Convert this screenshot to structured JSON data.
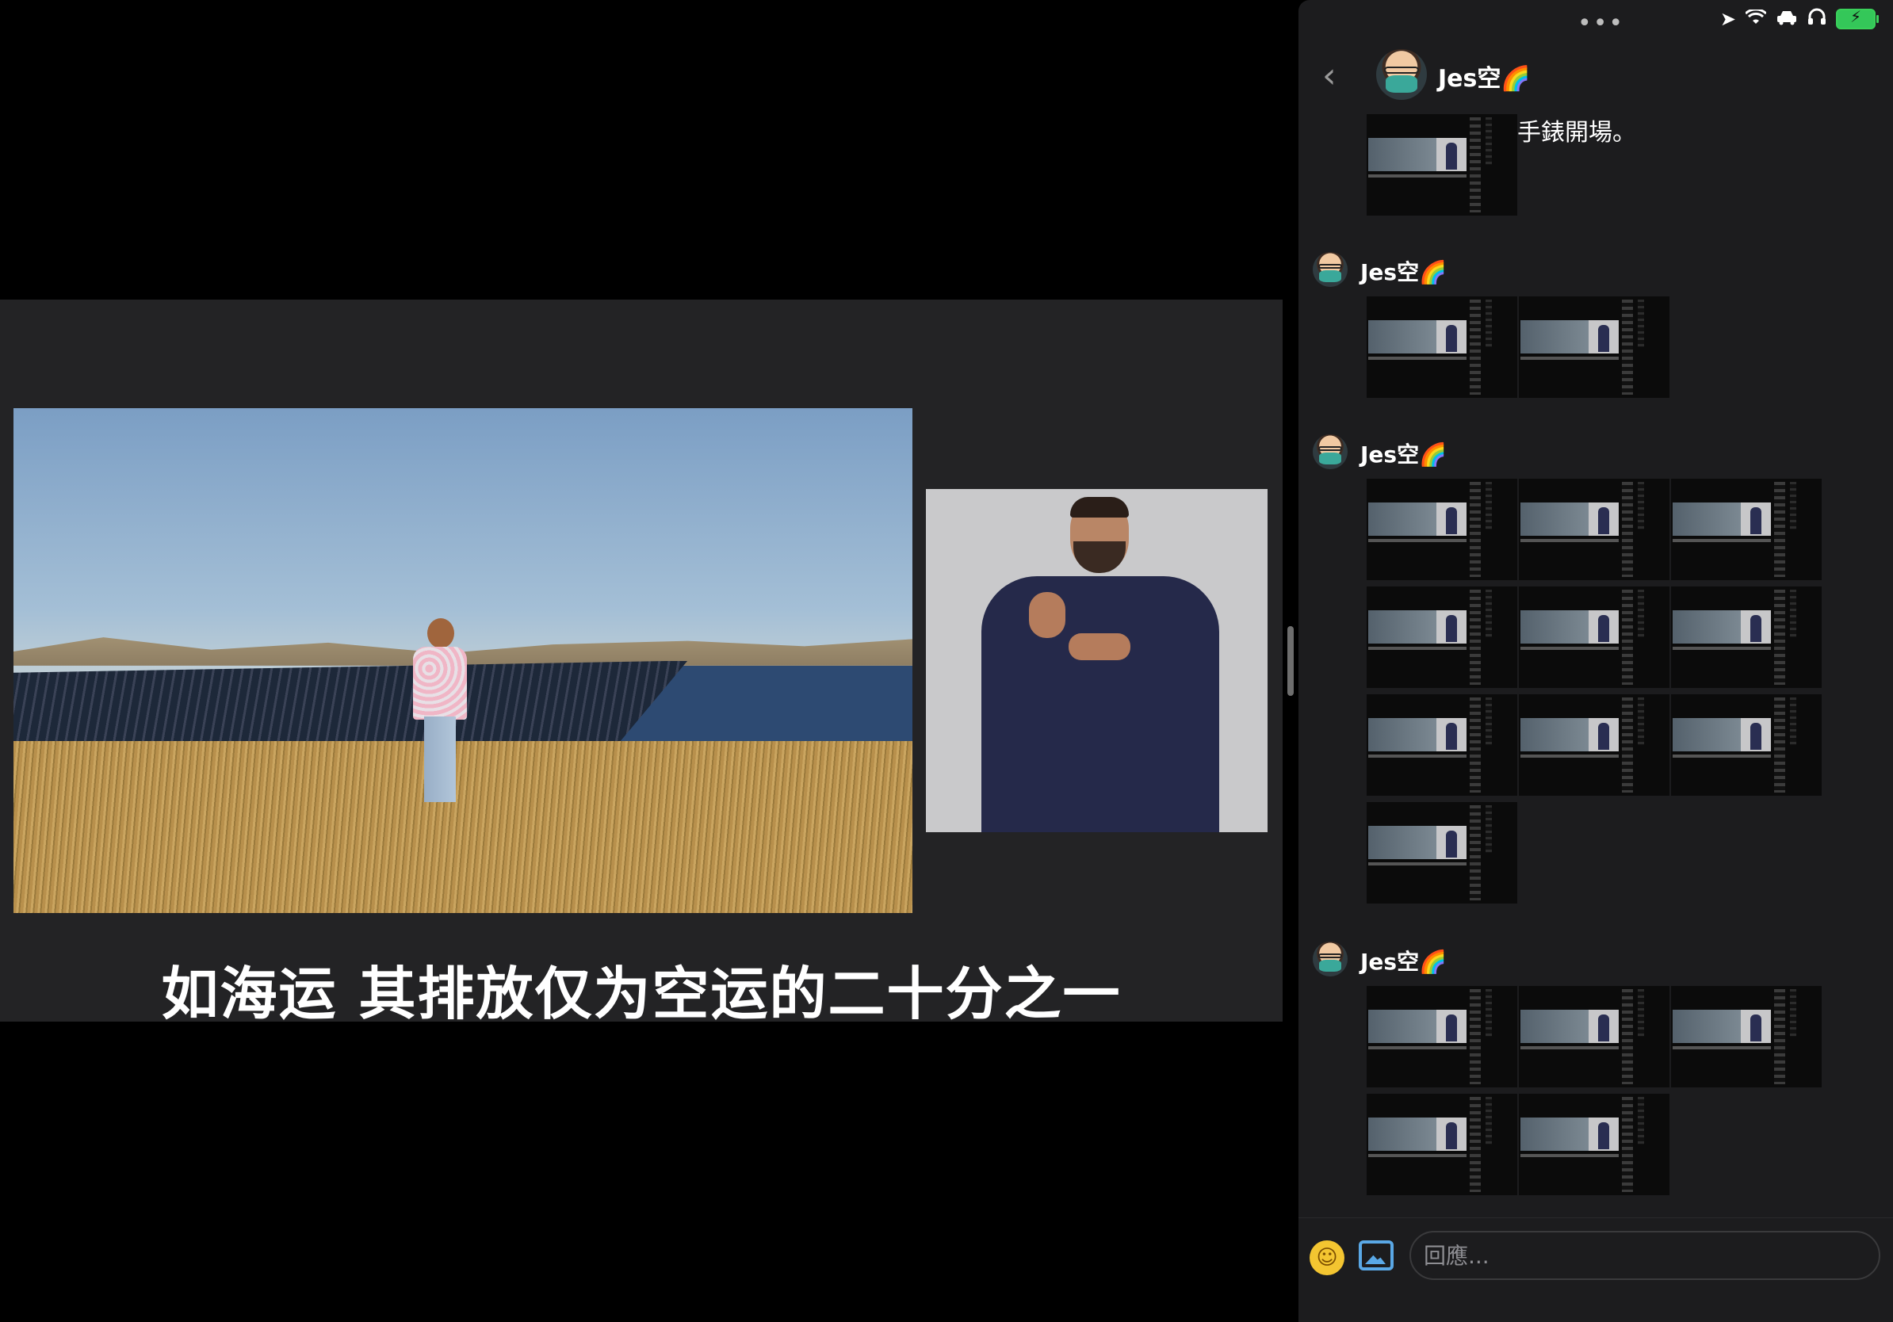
{
  "video": {
    "subtitle": "如海运 其排放仅为空运的二十分之一"
  },
  "status_bar": {
    "multitask_dots": "•••",
    "location_icon": "location-arrow-icon",
    "wifi_icon": "wifi-icon",
    "car_icon": "car-icon",
    "headphones_icon": "headphones-icon",
    "battery_icon": "battery-charging-icon",
    "battery_color": "#34c759"
  },
  "chat": {
    "back_label": "‹",
    "contact_name": "Jes空🌈",
    "messages": [
      {
        "sender": "",
        "text": "手錶開場。",
        "thumbnails": 1
      },
      {
        "sender": "Jes空🌈",
        "text": "",
        "thumbnails": 2
      },
      {
        "sender": "Jes空🌈",
        "text": "",
        "thumbnails": 10
      },
      {
        "sender": "Jes空🌈",
        "text": "",
        "thumbnails": 5
      }
    ],
    "reply_placeholder": "回應...",
    "emoji_icon": "smiley-icon",
    "photo_icon": "photo-icon",
    "accent_photo": "#5aa8e6",
    "accent_emoji": "#f3c531"
  }
}
